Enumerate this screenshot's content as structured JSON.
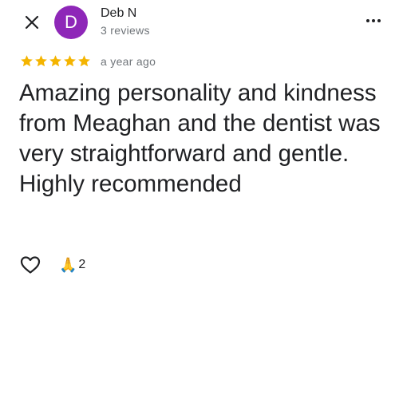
{
  "header": {
    "close_icon": "close-icon",
    "avatar_initial": "D",
    "avatar_color": "#8e27b8",
    "author_name": "Deb N",
    "review_count": "3 reviews",
    "more_icon": "more-vert-icon"
  },
  "review": {
    "rating": 5,
    "rating_max": 5,
    "star_color": "#f4b400",
    "time_ago": "a year ago",
    "text": "Amazing personality and kindness from Meaghan and the dentist was very straightforward and gentle. Highly recommended"
  },
  "actions": {
    "like_icon": "heart-outline-icon",
    "reaction_emoji": "🙏",
    "reaction_count": "2"
  }
}
